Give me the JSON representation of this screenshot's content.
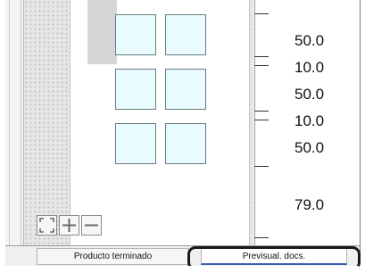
{
  "ruler": {
    "values": [
      "50.0",
      "10.0",
      "50.0",
      "10.0",
      "50.0",
      "79.0"
    ]
  },
  "zoom_controls": {
    "fit": "fit-to-screen-icon",
    "zoom_in": "plus-icon",
    "zoom_out": "minus-icon"
  },
  "tabs": [
    {
      "label": "Producto terminado",
      "active": false
    },
    {
      "label": "Previsual. docs.",
      "active": true
    }
  ],
  "colors": {
    "tile_fill": "#e8fcff",
    "tile_border": "#6b7b80",
    "active_tab_underline": "#3a5fb0"
  }
}
